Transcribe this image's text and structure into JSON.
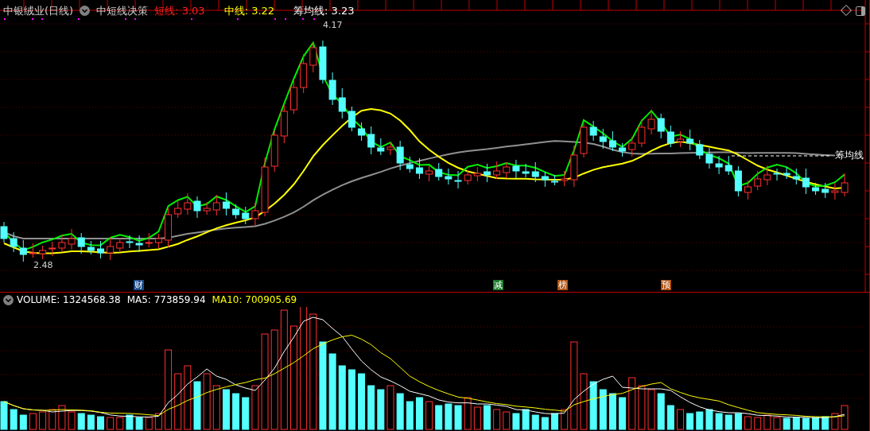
{
  "header": {
    "title": "中银绒业(日线)",
    "indicator": "中短线决策",
    "lines": [
      {
        "text": "短线: 3.03",
        "color": "#ff2020"
      },
      {
        "text": "中线: 3.22",
        "color": "#ffff00"
      },
      {
        "text": "筹均线: 3.23",
        "color": "#ffffff"
      }
    ]
  },
  "price_labels": [
    "4.17",
    "2.48"
  ],
  "line_label": "筹均线",
  "events": [
    {
      "text": "财",
      "color": "#1a4a8a"
    },
    {
      "text": "减",
      "color": "#1a7a2a"
    },
    {
      "text": "榜",
      "color": "#b05010"
    },
    {
      "text": "预",
      "color": "#b05010"
    }
  ],
  "volume": {
    "items": [
      {
        "text": "VOLUME: 1324568.38",
        "color": "#ffffff"
      },
      {
        "text": "MA5: 773859.94",
        "color": "#ffffff"
      },
      {
        "text": "MA10: 700905.69",
        "color": "#ffff00"
      }
    ]
  }
}
